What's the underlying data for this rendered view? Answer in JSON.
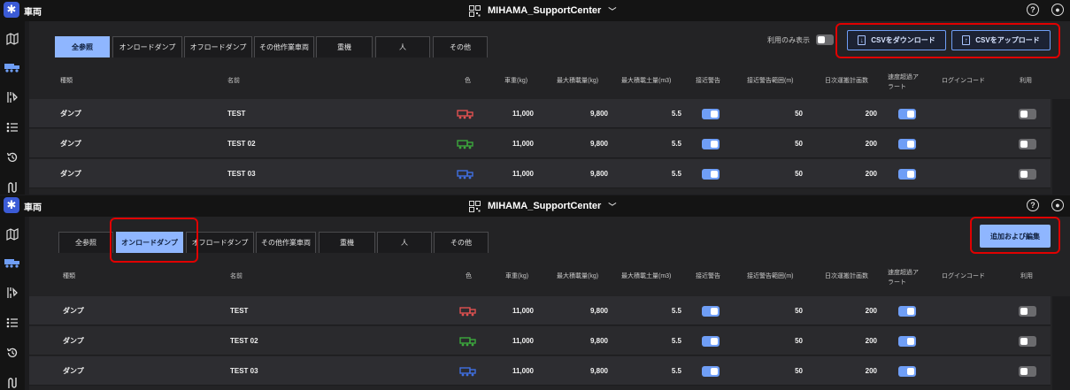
{
  "app": {
    "title": "車両",
    "site_name": "MIHAMA_SupportCenter"
  },
  "icons": [
    "map-icon",
    "truck-icon",
    "schedule-icon",
    "list-icon",
    "history-icon",
    "route-icon",
    "help-icon",
    "user-icon",
    "qr-icon"
  ],
  "colors": {
    "accent": "#8fb6ff",
    "highlight": "#e00000",
    "truck_red": "#e05050",
    "truck_green": "#3ca83c",
    "truck_blue": "#3f6fe0"
  },
  "tabs": [
    "全参照",
    "オンロードダンプ",
    "オフロードダンプ",
    "その他作業車両",
    "重機",
    "人",
    "その他"
  ],
  "top_panel": {
    "active_tab": "全参照",
    "filter_label": "利用のみ表示",
    "csv_download": "CSVをダウンロード",
    "csv_upload": "CSVをアップロード"
  },
  "bottom_panel": {
    "active_tab": "オンロードダンプ",
    "add_edit": "追加および編集"
  },
  "columns": {
    "type": "種類",
    "name": "名前",
    "color": "色",
    "weight": "車重(kg)",
    "max_load": "最大積載量(kg)",
    "max_volume": "最大積載土量(m3)",
    "proximity_alert": "接近警告",
    "proximity_range": "接近警告範囲(m)",
    "daily_plan": "日次運搬計画数",
    "speed_alert_1": "速度超過ア",
    "speed_alert_2": "ラート",
    "login_code": "ログインコード",
    "use": "利用"
  },
  "rows": [
    {
      "type": "ダンプ",
      "name": "TEST",
      "color": "red",
      "weight": "11,000",
      "max_load": "9,800",
      "max_volume": "5.5",
      "proximity_alert": true,
      "proximity_range": "50",
      "daily_plan": "200",
      "speed_alert": true,
      "login_code": "",
      "use": false
    },
    {
      "type": "ダンプ",
      "name": "TEST 02",
      "color": "green",
      "weight": "11,000",
      "max_load": "9,800",
      "max_volume": "5.5",
      "proximity_alert": true,
      "proximity_range": "50",
      "daily_plan": "200",
      "speed_alert": true,
      "login_code": "",
      "use": false
    },
    {
      "type": "ダンプ",
      "name": "TEST 03",
      "color": "blue",
      "weight": "11,000",
      "max_load": "9,800",
      "max_volume": "5.5",
      "proximity_alert": true,
      "proximity_range": "50",
      "daily_plan": "200",
      "speed_alert": true,
      "login_code": "",
      "use": false
    }
  ]
}
